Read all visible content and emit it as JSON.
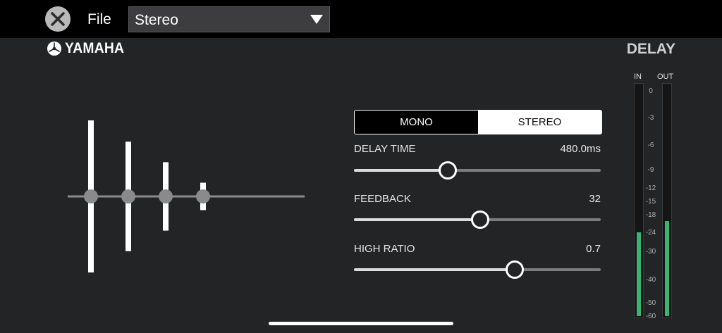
{
  "header": {
    "close_icon": "close-icon",
    "file_label": "File",
    "preset_value": "Stereo",
    "dropdown_icon": "triangle-down-icon"
  },
  "brand": {
    "logo_text": "YAMAHA",
    "logo_icon": "tuning-forks-emblem-icon"
  },
  "effect_title": "DELAY",
  "mode": {
    "options": [
      "MONO",
      "STEREO"
    ],
    "selected": "STEREO"
  },
  "params": [
    {
      "label": "DELAY TIME",
      "value": "480.0ms",
      "level": 0.38
    },
    {
      "label": "FEEDBACK",
      "value": "32",
      "level": 0.51
    },
    {
      "label": "HIGH RATIO",
      "value": "0.7",
      "level": 0.65
    }
  ],
  "echo_display": {
    "taps": [
      1.0,
      0.72,
      0.45,
      0.18
    ]
  },
  "meters": {
    "in_label": "IN",
    "out_label": "OUT",
    "in_level": 0.36,
    "out_level": 0.41,
    "scale": [
      "0",
      "-3",
      "-6",
      "-9",
      "-12",
      "-15",
      "-18",
      "-24",
      "-30",
      "-40",
      "-50",
      "-60"
    ]
  },
  "colors": {
    "background": "#232426",
    "topbar": "#000000",
    "meter_green": "#38b575"
  }
}
